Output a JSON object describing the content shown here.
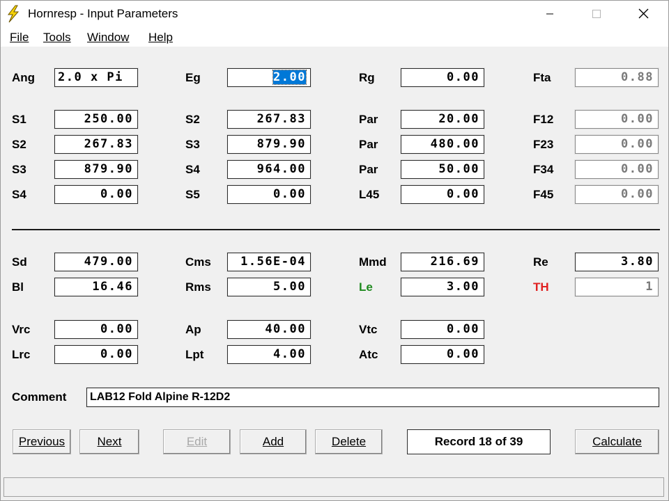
{
  "window": {
    "title": "Hornresp - Input Parameters",
    "minimize_glyph": "—",
    "maximize_glyph": "☐",
    "close_glyph": "✕"
  },
  "menu": [
    "File",
    "Tools",
    "Window",
    "Help"
  ],
  "rows": {
    "r0": [
      {
        "label": "Ang",
        "value": "2.0 x Pi",
        "mode": "left"
      },
      {
        "label": "Eg",
        "value": "2.00",
        "mode": "sel"
      },
      {
        "label": "Rg",
        "value": "0.00",
        "mode": ""
      },
      {
        "label": "Fta",
        "value": "0.88",
        "mode": "ro"
      }
    ],
    "r1": [
      {
        "label": "S1",
        "value": "250.00",
        "mode": ""
      },
      {
        "label": "S2",
        "value": "267.83",
        "mode": ""
      },
      {
        "label": "Par",
        "value": "20.00",
        "mode": ""
      },
      {
        "label": "F12",
        "value": "0.00",
        "mode": "ro"
      }
    ],
    "r2": [
      {
        "label": "S2",
        "value": "267.83",
        "mode": ""
      },
      {
        "label": "S3",
        "value": "879.90",
        "mode": ""
      },
      {
        "label": "Par",
        "value": "480.00",
        "mode": ""
      },
      {
        "label": "F23",
        "value": "0.00",
        "mode": "ro"
      }
    ],
    "r3": [
      {
        "label": "S3",
        "value": "879.90",
        "mode": ""
      },
      {
        "label": "S4",
        "value": "964.00",
        "mode": ""
      },
      {
        "label": "Par",
        "value": "50.00",
        "mode": ""
      },
      {
        "label": "F34",
        "value": "0.00",
        "mode": "ro"
      }
    ],
    "r4": [
      {
        "label": "S4",
        "value": "0.00",
        "mode": ""
      },
      {
        "label": "S5",
        "value": "0.00",
        "mode": ""
      },
      {
        "label": "L45",
        "value": "0.00",
        "mode": ""
      },
      {
        "label": "F45",
        "value": "0.00",
        "mode": "ro"
      }
    ],
    "r5": [
      {
        "label": "Sd",
        "value": "479.00",
        "mode": ""
      },
      {
        "label": "Cms",
        "value": "1.56E-04",
        "mode": ""
      },
      {
        "label": "Mmd",
        "value": "216.69",
        "mode": ""
      },
      {
        "label": "Re",
        "value": "3.80",
        "mode": ""
      }
    ],
    "r6": [
      {
        "label": "Bl",
        "value": "16.46",
        "mode": ""
      },
      {
        "label": "Rms",
        "value": "5.00",
        "mode": ""
      },
      {
        "label": "Le",
        "value": "3.00",
        "mode": "",
        "color": "#1f8a1f"
      },
      {
        "label": "TH",
        "value": "1",
        "mode": "ro",
        "color": "#e02020"
      }
    ],
    "r7": [
      {
        "label": "Vrc",
        "value": "0.00",
        "mode": ""
      },
      {
        "label": "Ap",
        "value": "40.00",
        "mode": ""
      },
      {
        "label": "Vtc",
        "value": "0.00",
        "mode": ""
      }
    ],
    "r8": [
      {
        "label": "Lrc",
        "value": "0.00",
        "mode": ""
      },
      {
        "label": "Lpt",
        "value": "4.00",
        "mode": ""
      },
      {
        "label": "Atc",
        "value": "0.00",
        "mode": ""
      }
    ]
  },
  "comment": {
    "label": "Comment",
    "value": "LAB12 Fold Alpine R-12D2"
  },
  "buttons": {
    "previous": "Previous",
    "next": "Next",
    "edit": "Edit",
    "add": "Add",
    "delete": "Delete",
    "calculate": "Calculate"
  },
  "record": "Record 18 of 39",
  "colors": {
    "selection": "#0078d7",
    "le_label": "#1f8a1f",
    "th_label": "#e02020"
  }
}
